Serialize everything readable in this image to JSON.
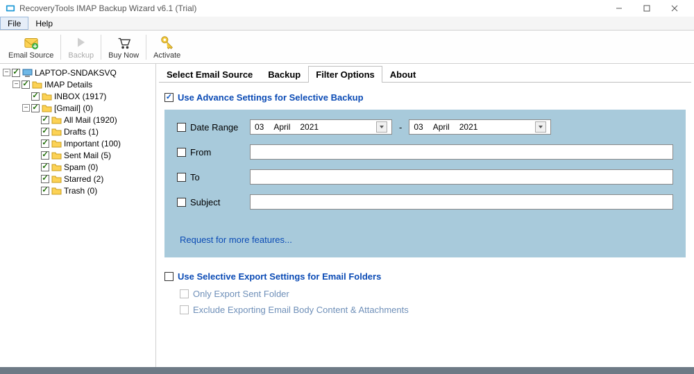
{
  "window": {
    "title": "RecoveryTools IMAP Backup Wizard v6.1 (Trial)"
  },
  "menu": {
    "file": "File",
    "help": "Help"
  },
  "toolbar": {
    "email_source": "Email Source",
    "backup": "Backup",
    "buy_now": "Buy Now",
    "activate": "Activate"
  },
  "tree": {
    "root": "LAPTOP-SNDAKSVQ",
    "imap_details": "IMAP Details",
    "inbox": "INBOX (1917)",
    "gmail": "[Gmail] (0)",
    "all_mail": "All Mail (1920)",
    "drafts": "Drafts (1)",
    "important": "Important (100)",
    "sent_mail": "Sent Mail (5)",
    "spam": "Spam (0)",
    "starred": "Starred (2)",
    "trash": "Trash (0)"
  },
  "tabs": {
    "select_source": "Select Email Source",
    "backup": "Backup",
    "filter_options": "Filter Options",
    "about": "About"
  },
  "filter": {
    "advance_label": "Use Advance Settings for Selective Backup",
    "date_range": "Date Range",
    "from": "From",
    "to": "To",
    "subject": "Subject",
    "date1_day": "03",
    "date1_month": "April",
    "date1_year": "2021",
    "date2_day": "03",
    "date2_month": "April",
    "date2_year": "2021",
    "dash": "-",
    "request_link": "Request for more features...",
    "selective_export": "Use Selective Export Settings for Email Folders",
    "only_sent": "Only Export Sent Folder",
    "exclude_body": "Exclude Exporting Email Body Content & Attachments"
  }
}
